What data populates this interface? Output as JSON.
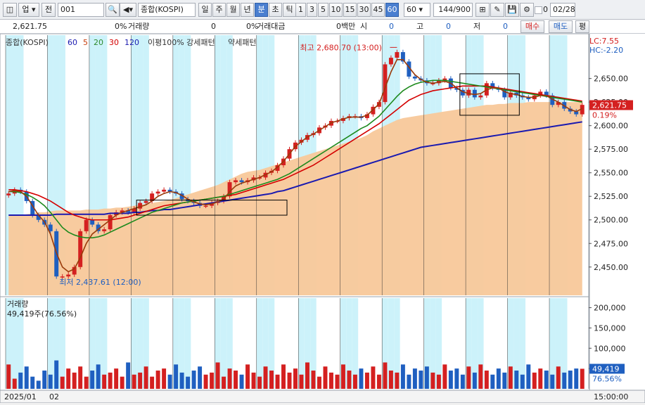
{
  "toolbar": {
    "market_select": "업",
    "prev_button": "전",
    "code_value": "001",
    "name_value": "종합(KOSPI)",
    "period_tabs": [
      "일",
      "주",
      "월",
      "년",
      "분",
      "초",
      "틱"
    ],
    "active_period": "분",
    "interval_buttons": [
      "1",
      "3",
      "5",
      "10",
      "15",
      "30",
      "45",
      "60"
    ],
    "active_interval": "60",
    "interval_value": "60",
    "count_value": "144",
    "count_max": "/900",
    "checkbox_label": "0",
    "date_value": "02/28"
  },
  "infobar": {
    "price": "2,621.75",
    "change_pct": "0%",
    "volume_label": "거래량",
    "volume_value": "0",
    "amount_pct": "0%",
    "amount_label": "거래대금",
    "amount_unit": "0백만",
    "open_label": "시",
    "open_value": "0",
    "high_label": "고",
    "high_value": "0",
    "low_label": "저",
    "low_value": "0",
    "buy_button": "매수",
    "sell_button": "매도",
    "eval_button": "평"
  },
  "chart_legend": {
    "name": "종합(KOSPI)",
    "ma": [
      "60",
      "5",
      "20",
      "30",
      "120"
    ],
    "ma_colors": [
      "#1a1ab0",
      "#c8400f",
      "#2d8a2d",
      "#d40000",
      "#1a1ab0"
    ],
    "pattern_label": "이평100% 강세패턴",
    "weak_label": "약세패턴"
  },
  "price_panel": {
    "lc_label": "LC:7.55",
    "hc_label": "HC:-2.20",
    "high_annotation": "최고 2,680.70 (13:00)",
    "low_annotation": "최저 2,437.61 (12:00)",
    "current_price": "2,621.75",
    "current_pct": "0.19%",
    "y_ticks": [
      "2,650.00",
      "2,625.00",
      "2,600.00",
      "2,575.00",
      "2,550.00",
      "2,525.00",
      "2,500.00",
      "2,475.00",
      "2,450.00"
    ],
    "y_min": 2420,
    "y_max": 2690
  },
  "volume_panel": {
    "title": "거래량",
    "value_label": "49,419주(76.56%)",
    "y_ticks": [
      "200,000",
      "150,000",
      "100,000",
      "50,000"
    ],
    "current_value": "49,419",
    "current_pct": "76.56%"
  },
  "x_axis": {
    "labels": [
      "2025/01",
      "02"
    ],
    "right_label": "15:00:00"
  },
  "colors": {
    "up": "#d42020",
    "down": "#1f5fc0",
    "band_fill": "#f8c89a",
    "stripe": "#ccf2fa"
  },
  "chart_data": {
    "type": "line",
    "close": [
      2528,
      2532,
      2530,
      2520,
      2505,
      2500,
      2495,
      2488,
      2440,
      2440,
      2442,
      2450,
      2488,
      2500,
      2495,
      2488,
      2490,
      2505,
      2508,
      2510,
      2508,
      2512,
      2518,
      2520,
      2528,
      2530,
      2532,
      2530,
      2528,
      2522,
      2520,
      2518,
      2515,
      2515,
      2518,
      2520,
      2525,
      2540,
      2542,
      2540,
      2542,
      2545,
      2545,
      2550,
      2552,
      2558,
      2565,
      2575,
      2582,
      2585,
      2590,
      2592,
      2598,
      2600,
      2605,
      2605,
      2608,
      2610,
      2610,
      2608,
      2612,
      2620,
      2625,
      2665,
      2672,
      2678,
      2668,
      2652,
      2650,
      2648,
      2645,
      2645,
      2648,
      2650,
      2640,
      2638,
      2632,
      2638,
      2630,
      2632,
      2645,
      2640,
      2638,
      2630,
      2635,
      2632,
      2630,
      2628,
      2632,
      2636,
      2632,
      2622,
      2625,
      2618,
      2615,
      2612,
      2622
    ],
    "ma60": [
      2505,
      2505,
      2505,
      2506,
      2507,
      2508,
      2508,
      2509,
      2510,
      2510,
      2510,
      2510,
      2510,
      2511,
      2511,
      2511,
      2512,
      2512,
      2513,
      2513,
      2514,
      2515,
      2516,
      2517,
      2518,
      2519,
      2520,
      2521,
      2523,
      2525,
      2527,
      2529,
      2531,
      2533,
      2535,
      2537,
      2540,
      2543,
      2546,
      2549,
      2551,
      2552,
      2553,
      2555,
      2557,
      2559,
      2561,
      2563,
      2565,
      2567,
      2569,
      2571,
      2573,
      2575,
      2577,
      2579,
      2581,
      2583,
      2585,
      2587,
      2590,
      2594,
      2597,
      2600,
      2603,
      2606,
      2608,
      2609,
      2610,
      2611,
      2612,
      2613,
      2614,
      2615,
      2616,
      2617,
      2618,
      2619,
      2620,
      2621,
      2622,
      2622,
      2623,
      2623,
      2624,
      2624,
      2624,
      2625,
      2625,
      2625,
      2625,
      2625,
      2625,
      2625,
      2625,
      2625,
      2625
    ],
    "ma120": [
      2505,
      2505,
      2505,
      2505,
      2505,
      2505,
      2505,
      2505,
      2506,
      2506,
      2506,
      2506,
      2506,
      2506,
      2506,
      2506,
      2506,
      2507,
      2507,
      2507,
      2507,
      2508,
      2508,
      2509,
      2510,
      2510,
      2511,
      2511,
      2512,
      2513,
      2514,
      2515,
      2516,
      2517,
      2518,
      2519,
      2520,
      2521,
      2522,
      2523,
      2524,
      2525,
      2526,
      2527,
      2528,
      2530,
      2531,
      2533,
      2535,
      2537,
      2539,
      2541,
      2543,
      2545,
      2547,
      2549,
      2551,
      2553,
      2555,
      2557,
      2559,
      2561,
      2563,
      2565,
      2567,
      2569,
      2571,
      2573,
      2575,
      2577,
      2578,
      2579,
      2580,
      2581,
      2582,
      2583,
      2584,
      2585,
      2586,
      2587,
      2588,
      2589,
      2590,
      2591,
      2592,
      2593,
      2594,
      2595,
      2596,
      2597,
      2598,
      2599,
      2600,
      2601,
      2602,
      2603,
      2604
    ],
    "ma20": [
      2530,
      2530,
      2529,
      2527,
      2524,
      2520,
      2515,
      2508,
      2500,
      2492,
      2487,
      2484,
      2482,
      2481,
      2481,
      2482,
      2484,
      2487,
      2490,
      2493,
      2496,
      2499,
      2502,
      2505,
      2508,
      2510,
      2512,
      2514,
      2516,
      2518,
      2519,
      2520,
      2521,
      2522,
      2523,
      2524,
      2525,
      2527,
      2529,
      2531,
      2533,
      2535,
      2537,
      2539,
      2541,
      2543,
      2546,
      2549,
      2553,
      2557,
      2561,
      2565,
      2569,
      2573,
      2577,
      2581,
      2585,
      2589,
      2593,
      2597,
      2600,
      2605,
      2610,
      2617,
      2624,
      2631,
      2637,
      2641,
      2644,
      2646,
      2647,
      2648,
      2648,
      2648,
      2647,
      2646,
      2645,
      2644,
      2643,
      2642,
      2641,
      2640,
      2639,
      2638,
      2637,
      2636,
      2635,
      2634,
      2633,
      2632,
      2631,
      2630,
      2629,
      2628,
      2627,
      2626,
      2625
    ],
    "ma30": [
      2532,
      2532,
      2531,
      2530,
      2528,
      2526,
      2523,
      2520,
      2516,
      2512,
      2508,
      2505,
      2503,
      2501,
      2500,
      2500,
      2500,
      2500,
      2501,
      2502,
      2503,
      2505,
      2507,
      2509,
      2511,
      2513,
      2515,
      2516,
      2517,
      2518,
      2519,
      2520,
      2521,
      2522,
      2523,
      2524,
      2525,
      2526,
      2527,
      2529,
      2531,
      2533,
      2535,
      2537,
      2539,
      2541,
      2543,
      2546,
      2549,
      2552,
      2555,
      2558,
      2562,
      2566,
      2570,
      2574,
      2578,
      2582,
      2586,
      2590,
      2594,
      2598,
      2602,
      2607,
      2612,
      2617,
      2622,
      2627,
      2630,
      2633,
      2635,
      2637,
      2638,
      2639,
      2640,
      2641,
      2642,
      2642,
      2642,
      2642,
      2642,
      2641,
      2640,
      2639,
      2638,
      2637,
      2636,
      2635,
      2634,
      2633,
      2632,
      2631,
      2630,
      2629,
      2628,
      2627,
      2626
    ],
    "ma5": [
      2530,
      2531,
      2530,
      2525,
      2515,
      2505,
      2498,
      2485,
      2465,
      2450,
      2445,
      2448,
      2460,
      2475,
      2485,
      2490,
      2495,
      2500,
      2505,
      2508,
      2510,
      2512,
      2514,
      2516,
      2520,
      2525,
      2528,
      2530,
      2529,
      2526,
      2522,
      2519,
      2517,
      2516,
      2517,
      2519,
      2522,
      2530,
      2536,
      2539,
      2541,
      2543,
      2545,
      2548,
      2551,
      2556,
      2562,
      2570,
      2578,
      2583,
      2588,
      2591,
      2595,
      2599,
      2603,
      2605,
      2607,
      2609,
      2609,
      2609,
      2611,
      2617,
      2623,
      2640,
      2657,
      2670,
      2670,
      2662,
      2654,
      2649,
      2646,
      2645,
      2646,
      2647,
      2645,
      2640,
      2636,
      2634,
      2633,
      2634,
      2638,
      2640,
      2640,
      2636,
      2634,
      2633,
      2631,
      2630,
      2630,
      2632,
      2632,
      2628,
      2625,
      2621,
      2617,
      2615,
      2618
    ],
    "volume": [
      60000,
      25000,
      40000,
      55000,
      30000,
      20000,
      45000,
      35000,
      70000,
      30000,
      50000,
      40000,
      55000,
      30000,
      45000,
      60000,
      35000,
      40000,
      50000,
      30000,
      65000,
      35000,
      40000,
      55000,
      30000,
      45000,
      50000,
      35000,
      60000,
      40000,
      30000,
      45000,
      55000,
      35000,
      40000,
      65000,
      30000,
      50000,
      45000,
      35000,
      60000,
      40000,
      30000,
      55000,
      45000,
      35000,
      60000,
      40000,
      50000,
      35000,
      65000,
      45000,
      30000,
      55000,
      40000,
      35000,
      60000,
      45000,
      35000,
      50000,
      40000,
      55000,
      35000,
      65000,
      45000,
      40000,
      60000,
      35000,
      50000,
      45000,
      55000,
      40000,
      35000,
      60000,
      45000,
      50000,
      35000,
      55000,
      40000,
      60000,
      45000,
      35000,
      50000,
      40000,
      55000,
      45000,
      35000,
      60000,
      40000,
      50000,
      45000,
      35000,
      55000,
      40000,
      45000,
      50000,
      49419
    ],
    "vol_max": 220000
  }
}
